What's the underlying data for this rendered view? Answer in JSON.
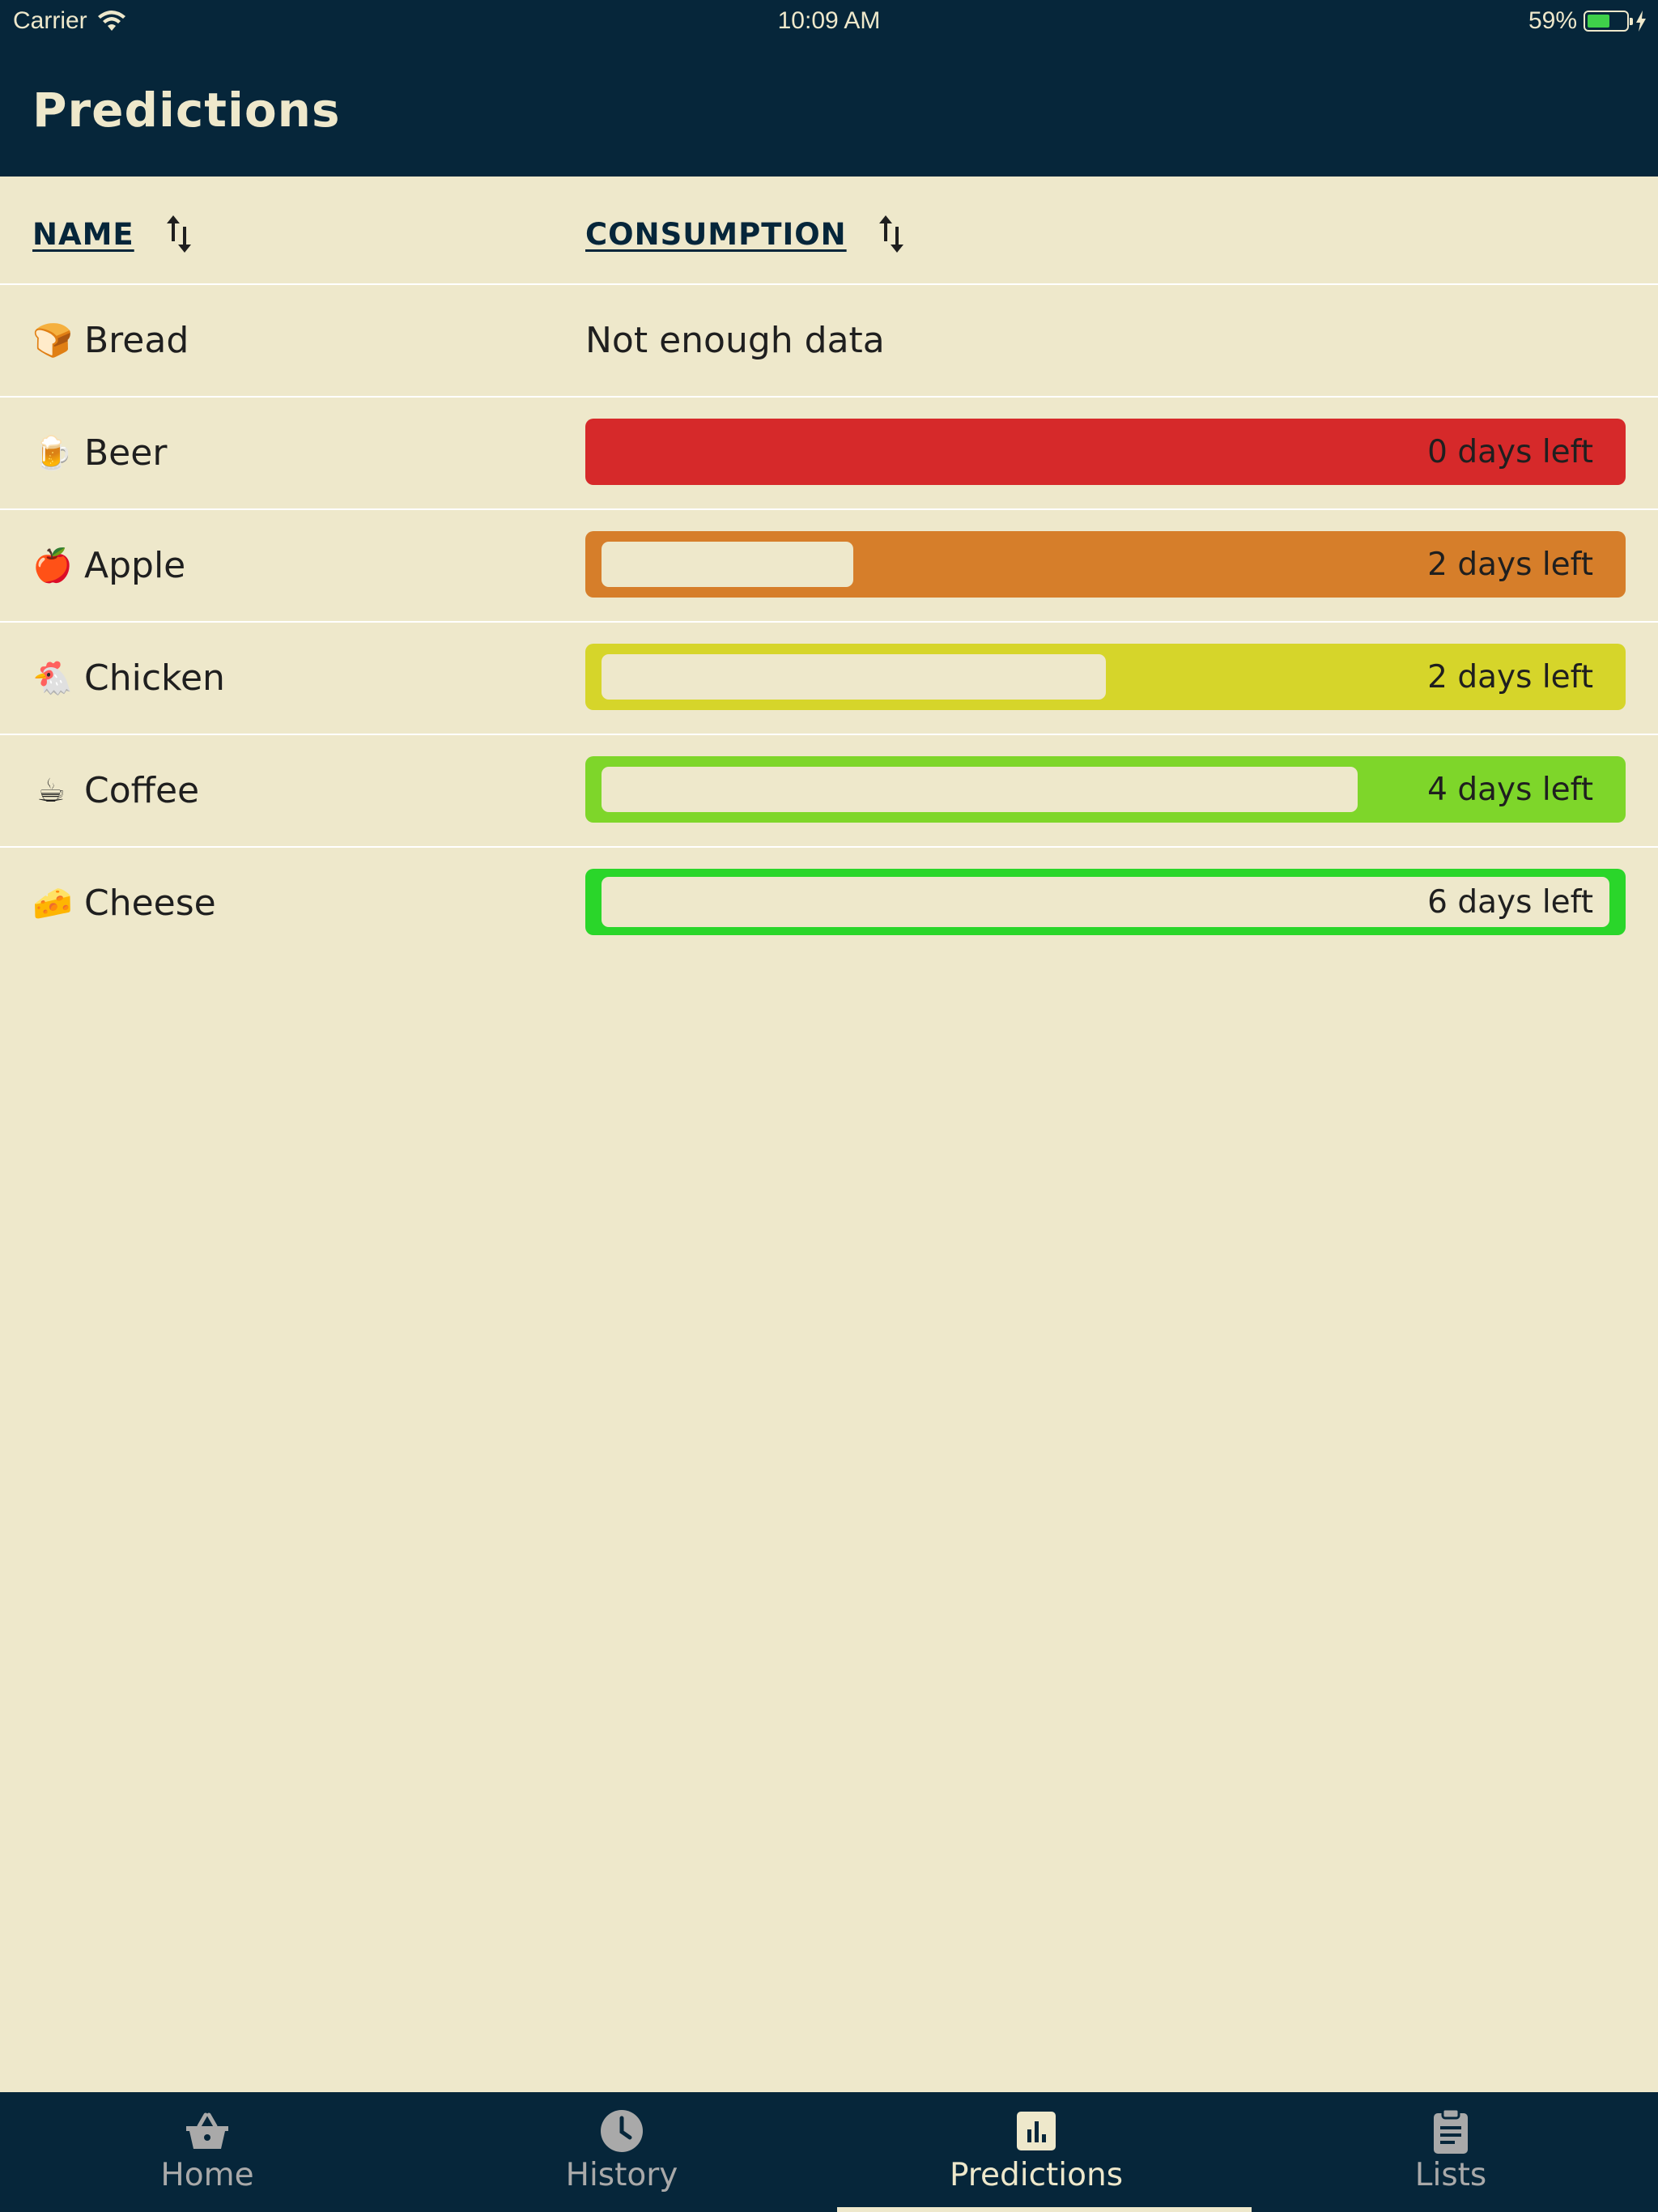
{
  "status_bar": {
    "carrier": "Carrier",
    "time": "10:09 AM",
    "battery_percent": "59%",
    "battery_level": 0.59
  },
  "app_bar": {
    "title": "Predictions"
  },
  "table": {
    "headers": {
      "name": "NAME",
      "consumption": "CONSUMPTION"
    },
    "rows": [
      {
        "emoji": "🍞",
        "name": "Bread",
        "status": "Not enough data"
      },
      {
        "emoji": "🍺",
        "name": "Beer",
        "days_left": "0 days left",
        "bar_color": "#D6292A",
        "remaining_fraction": 0.0
      },
      {
        "emoji": "🍎",
        "name": "Apple",
        "days_left": "2 days left",
        "bar_color": "#D67E2A",
        "remaining_fraction": 0.25
      },
      {
        "emoji": "🐔",
        "name": "Chicken",
        "days_left": "2 days left",
        "bar_color": "#D6D52A",
        "remaining_fraction": 0.5
      },
      {
        "emoji": "☕",
        "name": "Coffee",
        "days_left": "4 days left",
        "bar_color": "#7ED62A",
        "remaining_fraction": 0.75
      },
      {
        "emoji": "🧀",
        "name": "Cheese",
        "days_left": "6 days left",
        "bar_color": "#2AD62A",
        "remaining_fraction": 1.0
      }
    ]
  },
  "tab_bar": {
    "tabs": [
      {
        "label": "Home",
        "icon": "basket-icon"
      },
      {
        "label": "History",
        "icon": "clock-icon"
      },
      {
        "label": "Predictions",
        "icon": "bar-chart-icon",
        "active": true
      },
      {
        "label": "Lists",
        "icon": "clipboard-icon"
      }
    ]
  }
}
